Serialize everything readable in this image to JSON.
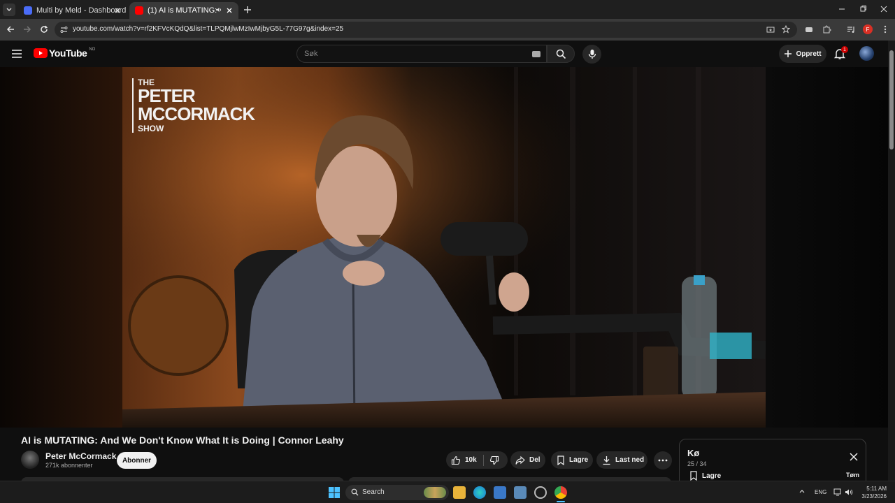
{
  "browser": {
    "tabs": [
      {
        "title": "Multi by Meld - Dashboard.",
        "active": false
      },
      {
        "title": "(1) AI is MUTATING: And We Don't Know What It is Doing | Connor Leahy",
        "active": true
      }
    ],
    "url": "youtube.com/watch?v=rf2KFVcKQdQ&list=TLPQMjlwMzIwMjbyG5L-77G97g&index=25",
    "profile_initial": "F"
  },
  "youtube": {
    "logo_text": "YouTube",
    "country_code": "NO",
    "search_placeholder": "Søk",
    "create_label": "Opprett",
    "notification_count": "1"
  },
  "video": {
    "overlay_brand": {
      "line1": "THE",
      "line2": "PETER",
      "line3": "MCCORMACK",
      "line4": "SHOW"
    },
    "title": "AI is MUTATING: And We Don't Know What It is Doing | Connor Leahy",
    "channel_name": "Peter McCormack",
    "subscribers": "271k abonnenter",
    "subscribe_label": "Abonner",
    "likes": "10k",
    "share_label": "Del",
    "save_label": "Lagre",
    "download_label": "Last ned"
  },
  "queue": {
    "title": "Kø",
    "position": "25 / 34",
    "save_label": "Lagre",
    "clear_label": "Tøm"
  },
  "taskbar": {
    "search_label": "Search",
    "language": "ENG",
    "time": "5:11 AM",
    "date": "3/23/2026"
  },
  "colors": {
    "youtube_red": "#ff0000",
    "background": "#0f0f0f",
    "chip": "#272727"
  }
}
